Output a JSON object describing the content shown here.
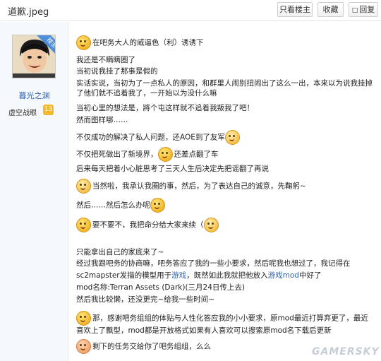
{
  "topbar": {
    "title": "道歉.jpeg",
    "only_author": "只看楼主",
    "favorite": "收藏",
    "reply": "回复"
  },
  "author": {
    "corner_badge": "楼主",
    "name": "暮光之渊",
    "rank": "虚空战眼",
    "level": "13"
  },
  "post": {
    "l1": "在吧务大人的威逼色（利）诱诱下",
    "l2": "我还是不瞒瞒圈了",
    "l3": "当初说我挂了那事是假的",
    "l4": "实话实说，当初为了一点私人的原因，和群里人闹别扭闹出了这么一出，本来以为说我挂掉了他们就不追着我了，一开始以为没什么嘛",
    "l5": "当初心里的想法是，將个屯这样就不追着我叛我了吧！",
    "l6": "然而图样哪……",
    "l7": "不仅成功的解决了私人问题，还AOE到了友军",
    "l8a": "不仅把死做出了新境界，",
    "l8b": "还差点翻了车",
    "l9": "后来每天把着小心脏思考了三天人生后决定先把谣翻了再说",
    "l10": "当然啦，我承认我圈的事，然后，为了表达自己的诚意，先鞠躬~",
    "l11": "然后……然后怎么办呢",
    "l12": "要不要不，我把命分给大家来续（",
    "l13": "只能拿出自己的家底来了~",
    "l14": "经过我跟吧务的协商嘛，吧务答应了我的一些小要求，然后呢我也想过了，我记得在",
    "l15a": "sc2mapster发描的模型用于",
    "l15b": "游戏",
    "l15c": "，既然如此我就把他放入",
    "l15d": "游戏mod",
    "l15e": "中好了",
    "l16": "mod名称:Terran Assets (Dark)(三月24日传上去)",
    "l17": "然后我比较懒，还没更完~给我一些时间~",
    "l18": "那，感谢吧务组组的体贴与人性化答应我的小小要求，原mod最近打算弃更了，最近喜欢上了飘型，mod都是开放格式如果有人喜欢可以搜索原mod名下载后更新",
    "l19": "剩下的任务交给你了吧务组组，么么"
  },
  "watermark": "GAMERSKY",
  "icons": [
    "reply-icon",
    "avatar-image",
    "smiley-emoticon",
    "level-badge"
  ]
}
